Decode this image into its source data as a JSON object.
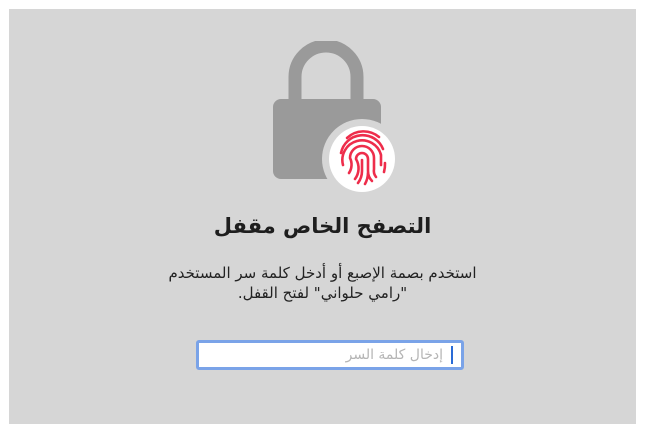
{
  "lock_screen": {
    "title": "التصفح الخاص مقفل",
    "message": "استخدم بصمة الإصبع أو أدخل كلمة سر المستخدم\n\"رامي حلواني\" لفتح القفل.",
    "password_placeholder": "إدخال كلمة السر"
  },
  "icons": {
    "lock": "padlock-icon",
    "fingerprint": "fingerprint-icon"
  },
  "colors": {
    "panel_background": "#d6d6d6",
    "lock_gray": "#9a9a9a",
    "fingerprint_red": "#ee2d4b",
    "focus_ring": "#7aa3e8",
    "cursor": "#2a6bd6"
  }
}
